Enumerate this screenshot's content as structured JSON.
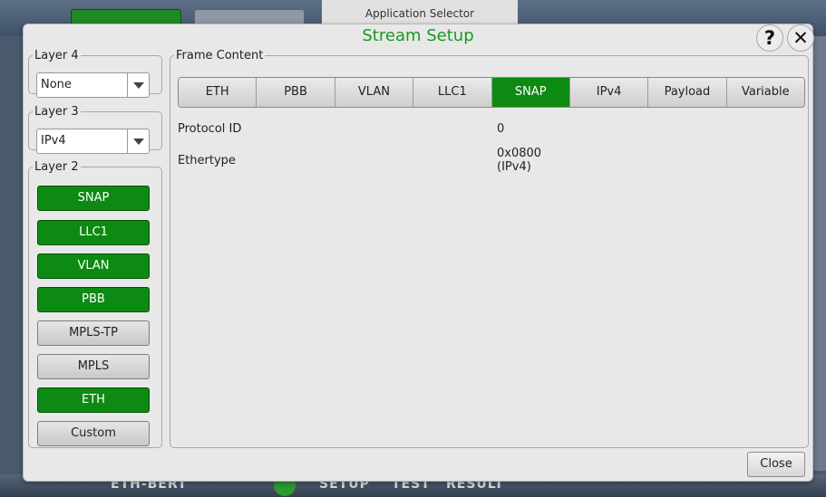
{
  "background": {
    "tab_title": "Application Selector",
    "bottom_labels": [
      "ETH-BERT",
      "SETUP",
      "TEST",
      "RESULT"
    ]
  },
  "dialog": {
    "title": "Stream Setup",
    "help_label": "?",
    "close_x_label": "✕",
    "close_button": "Close"
  },
  "layer4": {
    "legend": "Layer 4",
    "value": "None"
  },
  "layer3": {
    "legend": "Layer 3",
    "value": "IPv4"
  },
  "layer2": {
    "legend": "Layer 2",
    "buttons": [
      {
        "label": "SNAP",
        "active": true
      },
      {
        "label": "LLC1",
        "active": true
      },
      {
        "label": "VLAN",
        "active": true
      },
      {
        "label": "PBB",
        "active": true
      },
      {
        "label": "MPLS-TP",
        "active": false
      },
      {
        "label": "MPLS",
        "active": false
      },
      {
        "label": "ETH",
        "active": true
      },
      {
        "label": "Custom",
        "active": false
      }
    ]
  },
  "frame_content": {
    "legend": "Frame Content",
    "tabs": [
      "ETH",
      "PBB",
      "VLAN",
      "LLC1",
      "SNAP",
      "IPv4",
      "Payload",
      "Variable"
    ],
    "active_tab": "SNAP",
    "fields": [
      {
        "label": "Protocol ID",
        "value": "0"
      },
      {
        "label": "Ethertype",
        "value": "0x0800",
        "value2": "(IPv4)"
      }
    ]
  },
  "colors": {
    "accent_green": "#0c8a12",
    "title_green": "#169a1e"
  }
}
